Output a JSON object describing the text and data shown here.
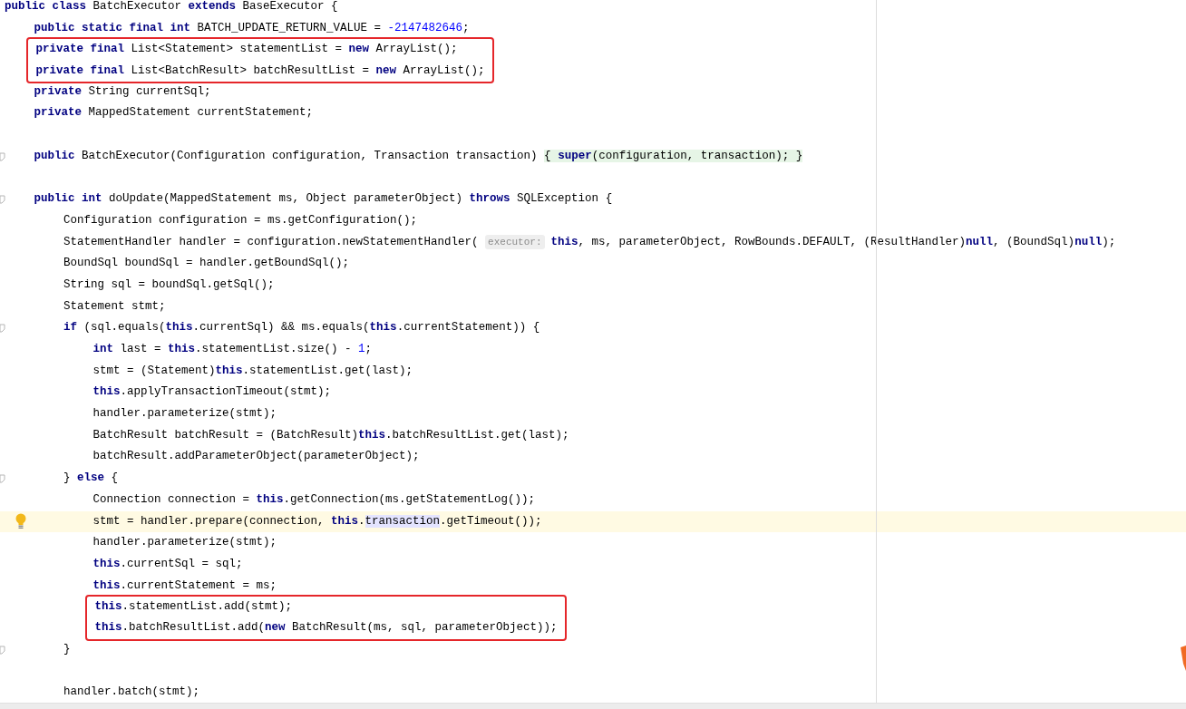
{
  "lines": [
    {
      "kind": "code",
      "current": false,
      "tokens": [
        {
          "kind": "kw",
          "text": "public class"
        },
        {
          "kind": "t",
          "text": " BatchExecutor "
        },
        {
          "kind": "kw",
          "text": "extends"
        },
        {
          "kind": "t",
          "text": " BaseExecutor {"
        }
      ],
      "children": [
        {
          "kind": "code",
          "current": false,
          "tokens": [
            {
              "kind": "kw",
              "text": "public static final int"
            },
            {
              "kind": "t",
              "text": " BATCH_UPDATE_RETURN_VALUE = "
            },
            {
              "kind": "num",
              "text": "-2147482646"
            },
            {
              "kind": "t",
              "text": ";"
            }
          ]
        },
        {
          "kind": "frame",
          "lines": [
            {
              "kind": "code",
              "current": false,
              "tokens": [
                {
                  "kind": "kw",
                  "text": "private final"
                },
                {
                  "kind": "t",
                  "text": " List<Statement> statementList = "
                },
                {
                  "kind": "kw",
                  "text": "new"
                },
                {
                  "kind": "t",
                  "text": " ArrayList();"
                }
              ]
            },
            {
              "kind": "code",
              "current": false,
              "tokens": [
                {
                  "kind": "kw",
                  "text": "private final"
                },
                {
                  "kind": "t",
                  "text": " List<BatchResult> batchResultList = "
                },
                {
                  "kind": "kw",
                  "text": "new"
                },
                {
                  "kind": "t",
                  "text": " ArrayList();"
                }
              ]
            }
          ]
        },
        {
          "kind": "code",
          "current": false,
          "tokens": [
            {
              "kind": "kw",
              "text": "private"
            },
            {
              "kind": "t",
              "text": " String currentSql;"
            }
          ]
        },
        {
          "kind": "code",
          "current": false,
          "tokens": [
            {
              "kind": "kw",
              "text": "private"
            },
            {
              "kind": "t",
              "text": " MappedStatement currentStatement;"
            }
          ]
        },
        {
          "kind": "blank"
        },
        {
          "kind": "fold",
          "current": false,
          "tokens": [
            {
              "kind": "kw",
              "text": "public"
            },
            {
              "kind": "t",
              "text": " BatchExecutor(Configuration configuration, Transaction transaction) "
            },
            {
              "kind": "fold",
              "text": "{ "
            },
            {
              "kind": "foldkw",
              "text": "super"
            },
            {
              "kind": "fold",
              "text": "(configuration, transaction); }"
            }
          ]
        },
        {
          "kind": "blank"
        },
        {
          "kind": "fold",
          "current": false,
          "tokens": [
            {
              "kind": "kw",
              "text": "public int"
            },
            {
              "kind": "t",
              "text": " doUpdate(MappedStatement ms, Object parameterObject) "
            },
            {
              "kind": "kw",
              "text": "throws"
            },
            {
              "kind": "t",
              "text": " SQLException {"
            }
          ],
          "children": [
            {
              "kind": "code",
              "current": false,
              "tokens": [
                {
                  "kind": "t",
                  "text": "Configuration configuration = ms.getConfiguration();"
                }
              ]
            },
            {
              "kind": "code",
              "current": false,
              "tokens": [
                {
                  "kind": "t",
                  "text": "StatementHandler handler = configuration.newStatementHandler( "
                },
                {
                  "kind": "hint",
                  "text": "executor:"
                },
                {
                  "kind": "kw",
                  "text": "this"
                },
                {
                  "kind": "t",
                  "text": ", ms, parameterObject, RowBounds.DEFAULT, (ResultHandler)"
                },
                {
                  "kind": "kw",
                  "text": "null"
                },
                {
                  "kind": "t",
                  "text": ", (BoundSql)"
                },
                {
                  "kind": "kw",
                  "text": "null"
                },
                {
                  "kind": "t",
                  "text": ");"
                }
              ]
            },
            {
              "kind": "code",
              "current": false,
              "tokens": [
                {
                  "kind": "t",
                  "text": "BoundSql boundSql = handler.getBoundSql();"
                }
              ]
            },
            {
              "kind": "code",
              "current": false,
              "tokens": [
                {
                  "kind": "t",
                  "text": "String sql = boundSql.getSql();"
                }
              ]
            },
            {
              "kind": "code",
              "current": false,
              "tokens": [
                {
                  "kind": "t",
                  "text": "Statement stmt;"
                }
              ]
            },
            {
              "kind": "fold",
              "current": false,
              "tokens": [
                {
                  "kind": "kw",
                  "text": "if"
                },
                {
                  "kind": "t",
                  "text": " (sql.equals("
                },
                {
                  "kind": "kw",
                  "text": "this"
                },
                {
                  "kind": "t",
                  "text": ".currentSql) && ms.equals("
                },
                {
                  "kind": "kw",
                  "text": "this"
                },
                {
                  "kind": "t",
                  "text": ".currentStatement)) {"
                }
              ],
              "children": [
                {
                  "kind": "code",
                  "current": false,
                  "tokens": [
                    {
                      "kind": "kw",
                      "text": "int"
                    },
                    {
                      "kind": "t",
                      "text": " last = "
                    },
                    {
                      "kind": "kw",
                      "text": "this"
                    },
                    {
                      "kind": "t",
                      "text": ".statementList.size() - "
                    },
                    {
                      "kind": "num",
                      "text": "1"
                    },
                    {
                      "kind": "t",
                      "text": ";"
                    }
                  ]
                },
                {
                  "kind": "code",
                  "current": false,
                  "tokens": [
                    {
                      "kind": "t",
                      "text": "stmt = (Statement)"
                    },
                    {
                      "kind": "kw",
                      "text": "this"
                    },
                    {
                      "kind": "t",
                      "text": ".statementList.get(last);"
                    }
                  ]
                },
                {
                  "kind": "code",
                  "current": false,
                  "tokens": [
                    {
                      "kind": "kw",
                      "text": "this"
                    },
                    {
                      "kind": "t",
                      "text": ".applyTransactionTimeout(stmt);"
                    }
                  ]
                },
                {
                  "kind": "code",
                  "current": false,
                  "tokens": [
                    {
                      "kind": "t",
                      "text": "handler.parameterize(stmt);"
                    }
                  ]
                },
                {
                  "kind": "code",
                  "current": false,
                  "tokens": [
                    {
                      "kind": "t",
                      "text": "BatchResult batchResult = (BatchResult)"
                    },
                    {
                      "kind": "kw",
                      "text": "this"
                    },
                    {
                      "kind": "t",
                      "text": ".batchResultList.get(last);"
                    }
                  ]
                },
                {
                  "kind": "code",
                  "current": false,
                  "tokens": [
                    {
                      "kind": "t",
                      "text": "batchResult.addParameterObject(parameterObject);"
                    }
                  ]
                }
              ]
            },
            {
              "kind": "fold",
              "current": false,
              "tokens": [
                {
                  "kind": "t",
                  "text": "} "
                },
                {
                  "kind": "kw",
                  "text": "else"
                },
                {
                  "kind": "t",
                  "text": " {"
                }
              ],
              "children": [
                {
                  "kind": "code",
                  "current": false,
                  "tokens": [
                    {
                      "kind": "t",
                      "text": "Connection connection = "
                    },
                    {
                      "kind": "kw",
                      "text": "this"
                    },
                    {
                      "kind": "t",
                      "text": ".getConnection(ms.getStatementLog());"
                    }
                  ]
                },
                {
                  "kind": "bulb",
                  "current": true,
                  "tokens": [
                    {
                      "kind": "t",
                      "text": "stmt = handler.prepare(connection, "
                    },
                    {
                      "kind": "kw",
                      "text": "this"
                    },
                    {
                      "kind": "t",
                      "text": "."
                    },
                    {
                      "kind": "ref",
                      "text": "transaction"
                    },
                    {
                      "kind": "t",
                      "text": ".getTimeout());"
                    }
                  ]
                },
                {
                  "kind": "code",
                  "current": false,
                  "tokens": [
                    {
                      "kind": "t",
                      "text": "handler.parameterize(stmt);"
                    }
                  ]
                },
                {
                  "kind": "code",
                  "current": false,
                  "tokens": [
                    {
                      "kind": "kw",
                      "text": "this"
                    },
                    {
                      "kind": "t",
                      "text": ".currentSql = sql;"
                    }
                  ]
                },
                {
                  "kind": "code",
                  "current": false,
                  "tokens": [
                    {
                      "kind": "kw",
                      "text": "this"
                    },
                    {
                      "kind": "t",
                      "text": ".currentStatement = ms;"
                    }
                  ]
                },
                {
                  "kind": "frame",
                  "lines": [
                    {
                      "kind": "code",
                      "current": false,
                      "tokens": [
                        {
                          "kind": "kw",
                          "text": "this"
                        },
                        {
                          "kind": "t",
                          "text": ".statementList.add(stmt);"
                        }
                      ]
                    },
                    {
                      "kind": "code",
                      "current": false,
                      "tokens": [
                        {
                          "kind": "kw",
                          "text": "this"
                        },
                        {
                          "kind": "t",
                          "text": ".batchResultList.add("
                        },
                        {
                          "kind": "kw",
                          "text": "new"
                        },
                        {
                          "kind": "t",
                          "text": " BatchResult(ms, sql, parameterObject));"
                        }
                      ]
                    }
                  ]
                }
              ]
            },
            {
              "kind": "fold",
              "current": false,
              "tokens": [
                {
                  "kind": "t",
                  "text": "}"
                }
              ]
            },
            {
              "kind": "blank"
            },
            {
              "kind": "code",
              "current": false,
              "tokens": [
                {
                  "kind": "t",
                  "text": "handler.batch(stmt);"
                }
              ]
            }
          ]
        }
      ]
    }
  ]
}
